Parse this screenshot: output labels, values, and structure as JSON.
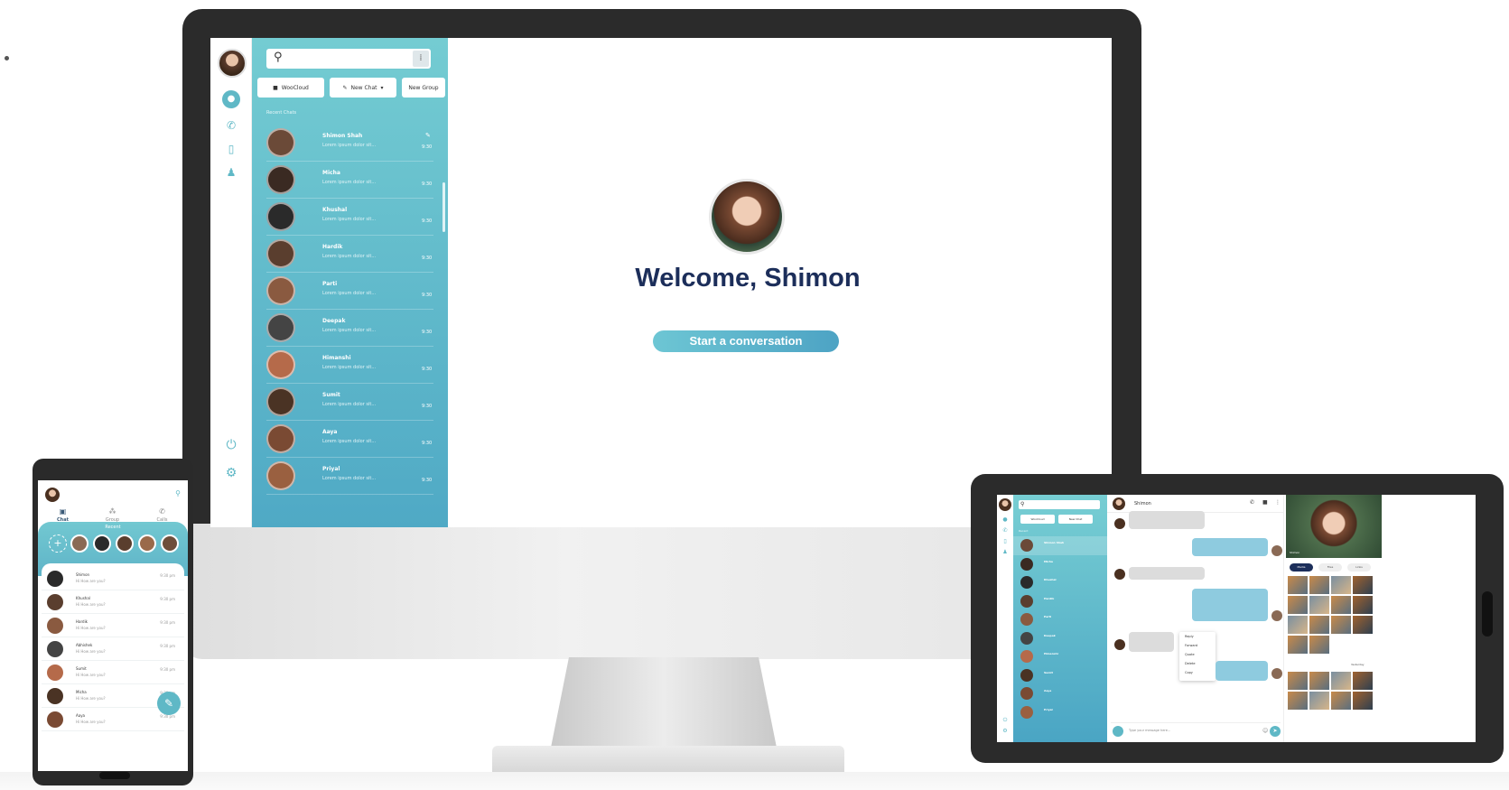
{
  "colors": {
    "accent": "#5fb8c6",
    "panel_top": "#74ccd2",
    "panel_bottom": "#4fa9c5",
    "title": "#1c2e5a"
  },
  "desktop": {
    "rail_icons": [
      "chat-icon",
      "phone-icon",
      "contacts-icon",
      "bell-icon"
    ],
    "bottom_icons": [
      "power-icon",
      "gear-icon"
    ],
    "buttons": [
      "WooCloud",
      "New Chat",
      "New Group"
    ],
    "recent_label": "Recent Chats",
    "chats": [
      {
        "name": "Shimon Shah",
        "msg": "Lorem ipsum dolor sit...",
        "time": "9:30"
      },
      {
        "name": "Micha",
        "msg": "Lorem ipsum dolor sit...",
        "time": "9:30"
      },
      {
        "name": "Khushal",
        "msg": "Lorem ipsum dolor sit...",
        "time": "9:30"
      },
      {
        "name": "Hardik",
        "msg": "Lorem ipsum dolor sit...",
        "time": "9:30"
      },
      {
        "name": "Parti",
        "msg": "Lorem ipsum dolor sit...",
        "time": "9:30"
      },
      {
        "name": "Deepak",
        "msg": "Lorem ipsum dolor sit...",
        "time": "9:30"
      },
      {
        "name": "Himanshi",
        "msg": "Lorem ipsum dolor sit...",
        "time": "9:30"
      },
      {
        "name": "Sumit",
        "msg": "Lorem ipsum dolor sit...",
        "time": "9:30"
      },
      {
        "name": "Aaya",
        "msg": "Lorem ipsum dolor sit...",
        "time": "9:30"
      },
      {
        "name": "Priyal",
        "msg": "Lorem ipsum dolor sit...",
        "time": "9:30"
      }
    ],
    "welcome": "Welcome, Shimon",
    "start_button": "Start a conversation"
  },
  "phone": {
    "tabs": [
      "Chat",
      "Group",
      "Calls"
    ],
    "recent_label": "Recent",
    "items": [
      {
        "name": "Shimon",
        "msg": "Hi How are you?",
        "time": "9:30 pm"
      },
      {
        "name": "Khushal",
        "msg": "Hi How are you?",
        "time": "9:30 pm"
      },
      {
        "name": "Hardik",
        "msg": "Hi How are you?",
        "time": "9:30 pm"
      },
      {
        "name": "Abhishek",
        "msg": "Hi How are you?",
        "time": "9:30 pm"
      },
      {
        "name": "Sumit",
        "msg": "Hi How are you?",
        "time": "9:30 pm"
      },
      {
        "name": "Micha",
        "msg": "Hi How are you?",
        "time": "9:30 pm"
      },
      {
        "name": "Aaya",
        "msg": "Hi How are you?",
        "time": "9:30 pm"
      }
    ]
  },
  "tablet": {
    "buttons": [
      "WooCloud",
      "New Chat"
    ],
    "recent_label": "Recent",
    "list": [
      "Shimon Shah",
      "Micha",
      "Khushal",
      "Hardik",
      "Parti",
      "Deepak",
      "Himanshi",
      "Sumit",
      "Aaya",
      "Priyal"
    ],
    "chat_name": "Shimon",
    "context_menu": [
      "Reply",
      "Forward",
      "Quote",
      "Delete",
      "Copy"
    ],
    "compose_placeholder": "Type your message here...",
    "profile_name": "Shimon",
    "profile_tabs": [
      "Media",
      "Files",
      "Links"
    ],
    "media_label": "Yesterday"
  }
}
